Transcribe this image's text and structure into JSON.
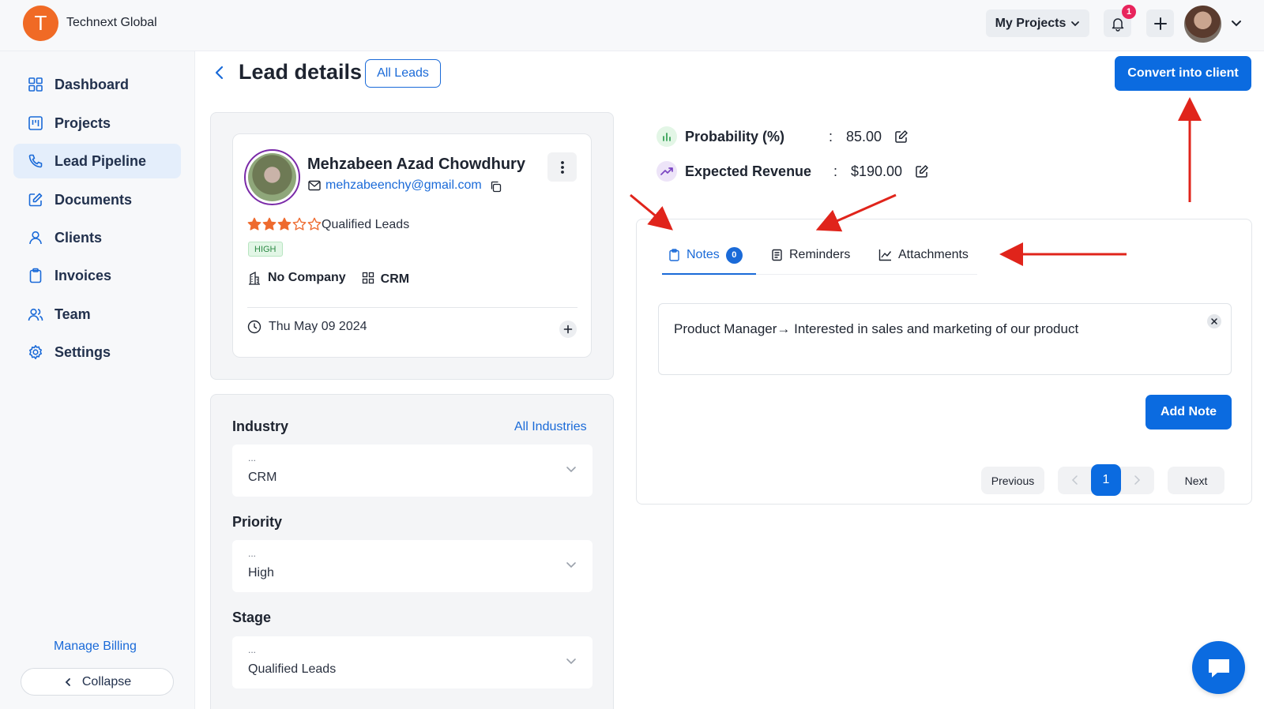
{
  "brand": {
    "logo_letter": "T",
    "name": "Technext Global"
  },
  "topbar": {
    "projects_label": "My Projects",
    "notification_count": "1"
  },
  "sidebar": {
    "items": [
      {
        "label": "Dashboard",
        "icon": "grid-icon"
      },
      {
        "label": "Projects",
        "icon": "kanban-icon"
      },
      {
        "label": "Lead Pipeline",
        "icon": "phone-icon",
        "active": true
      },
      {
        "label": "Documents",
        "icon": "edit-icon"
      },
      {
        "label": "Clients",
        "icon": "user-icon"
      },
      {
        "label": "Invoices",
        "icon": "clipboard-icon"
      },
      {
        "label": "Team",
        "icon": "users-icon"
      },
      {
        "label": "Settings",
        "icon": "gear-icon"
      }
    ],
    "manage_billing": "Manage Billing",
    "collapse": "Collapse"
  },
  "header": {
    "title": "Lead details",
    "all_leads": "All Leads",
    "convert_button": "Convert into client"
  },
  "lead": {
    "name": "Mehzabeen Azad Chowdhury",
    "email": "mehzabeenchy@gmail.com",
    "rating": 3,
    "rating_max": 5,
    "stage": "Qualified Leads",
    "priority_badge": "HIGH",
    "company": "No Company",
    "industry_tag": "CRM",
    "date": "Thu May 09 2024"
  },
  "fields": {
    "industry": {
      "label": "Industry",
      "link": "All Industries",
      "dots": "...",
      "value": "CRM"
    },
    "priority": {
      "label": "Priority",
      "dots": "...",
      "value": "High"
    },
    "stage": {
      "label": "Stage",
      "dots": "...",
      "value": "Qualified Leads"
    }
  },
  "metrics": {
    "probability": {
      "label": "Probability (%)",
      "sep": ":",
      "value": "85.00"
    },
    "revenue": {
      "label": "Expected Revenue",
      "sep": ":",
      "value": "$190.00"
    }
  },
  "tabs": [
    {
      "label": "Notes",
      "count": "0",
      "active": true,
      "icon": "clipboard-icon"
    },
    {
      "label": "Reminders",
      "icon": "document-icon"
    },
    {
      "label": "Attachments",
      "icon": "chart-line-icon"
    }
  ],
  "notes": {
    "text": "Product Manager→ Interested in sales and marketing of our product",
    "add_button": "Add Note"
  },
  "pagination": {
    "previous": "Previous",
    "current": "1",
    "next": "Next"
  },
  "colors": {
    "primary": "#0b6be0",
    "brand_orange": "#f06a25",
    "annotation_red": "#e0241b",
    "star_orange": "#ee6a2e"
  }
}
